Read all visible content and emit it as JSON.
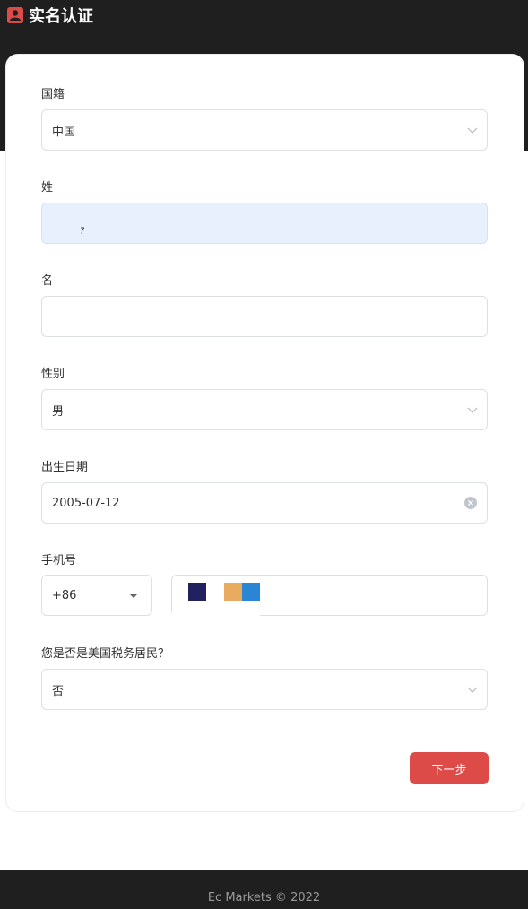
{
  "header": {
    "title": "实名认证",
    "icon": "user-icon"
  },
  "form": {
    "nationality": {
      "label": "国籍",
      "value": "中国"
    },
    "last_name": {
      "label": "姓",
      "value": ""
    },
    "first_name": {
      "label": "名",
      "value": ""
    },
    "gender": {
      "label": "性别",
      "value": "男"
    },
    "birth_date": {
      "label": "出生日期",
      "value": "2005-07-12"
    },
    "phone": {
      "label": "手机号",
      "country_code": "+86"
    },
    "us_tax_resident": {
      "label": "您是否是美国税务居民？",
      "value": "否"
    },
    "next_label": "下一步"
  },
  "footer": {
    "text": "Ec Markets © 2022"
  },
  "colors": {
    "accent": "#dd4b48",
    "dark": "#1f1f1f",
    "autofill": "#e8f0fe"
  }
}
